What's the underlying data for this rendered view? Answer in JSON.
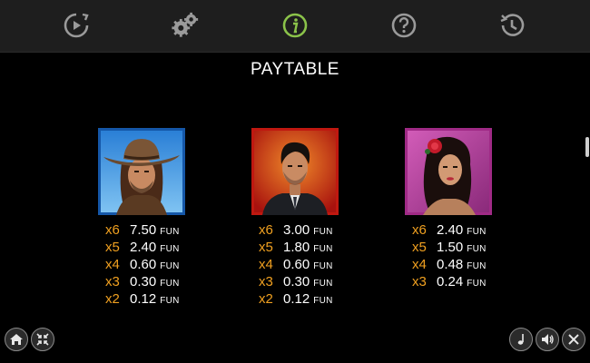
{
  "toolbar": {
    "icons": [
      "autoplay-icon",
      "settings-icon",
      "info-icon",
      "help-icon",
      "history-icon"
    ],
    "active": "info-icon",
    "active_color": "#8bc34a",
    "inactive_color": "#9a9a9a"
  },
  "page": {
    "title": "PAYTABLE"
  },
  "symbols": [
    {
      "name": "cowboy",
      "frame_color": "#1e73c8",
      "pays": [
        {
          "mult": "x6",
          "amount": "7.50",
          "unit": "FUN"
        },
        {
          "mult": "x5",
          "amount": "2.40",
          "unit": "FUN"
        },
        {
          "mult": "x4",
          "amount": "0.60",
          "unit": "FUN"
        },
        {
          "mult": "x3",
          "amount": "0.30",
          "unit": "FUN"
        },
        {
          "mult": "x2",
          "amount": "0.12",
          "unit": "FUN"
        }
      ]
    },
    {
      "name": "gentleman",
      "frame_color": "#c81e1e",
      "pays": [
        {
          "mult": "x6",
          "amount": "3.00",
          "unit": "FUN"
        },
        {
          "mult": "x5",
          "amount": "1.80",
          "unit": "FUN"
        },
        {
          "mult": "x4",
          "amount": "0.60",
          "unit": "FUN"
        },
        {
          "mult": "x3",
          "amount": "0.30",
          "unit": "FUN"
        },
        {
          "mult": "x2",
          "amount": "0.12",
          "unit": "FUN"
        }
      ]
    },
    {
      "name": "senorita",
      "frame_color": "#b02a8a",
      "pays": [
        {
          "mult": "x6",
          "amount": "2.40",
          "unit": "FUN"
        },
        {
          "mult": "x5",
          "amount": "1.50",
          "unit": "FUN"
        },
        {
          "mult": "x4",
          "amount": "0.48",
          "unit": "FUN"
        },
        {
          "mult": "x3",
          "amount": "0.24",
          "unit": "FUN"
        }
      ]
    }
  ],
  "bottom_left": [
    "home-icon",
    "collapse-icon"
  ],
  "bottom_right": [
    "music-icon",
    "sound-icon",
    "close-icon"
  ],
  "colors": {
    "multiplier": "#f0a020",
    "background": "#000000",
    "topbar": "#1e1e1e"
  }
}
